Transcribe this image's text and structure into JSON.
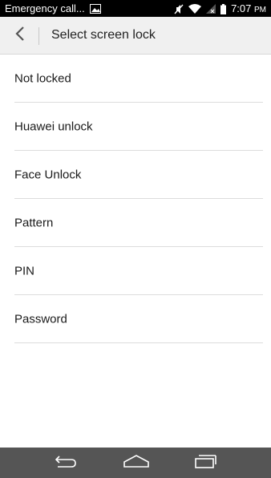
{
  "status_bar": {
    "carrier_text": "Emergency call...",
    "time": "7:07",
    "ampm": "PM",
    "icons": [
      "image-notification-icon",
      "mute-icon",
      "wifi-icon",
      "no-signal-icon",
      "battery-icon"
    ]
  },
  "action_bar": {
    "back_icon": "chevron-left-icon",
    "title": "Select screen lock"
  },
  "lock_options": [
    {
      "label": "Not locked"
    },
    {
      "label": "Huawei unlock"
    },
    {
      "label": "Face Unlock"
    },
    {
      "label": "Pattern"
    },
    {
      "label": "PIN"
    },
    {
      "label": "Password"
    }
  ],
  "nav_bar": {
    "icons": [
      "back-icon",
      "home-icon",
      "recent-apps-icon"
    ]
  },
  "colors": {
    "status_bar_bg": "#000000",
    "action_bar_bg": "#f0f0f0",
    "nav_bar_bg": "#555555",
    "divider": "#dcdcdc"
  }
}
